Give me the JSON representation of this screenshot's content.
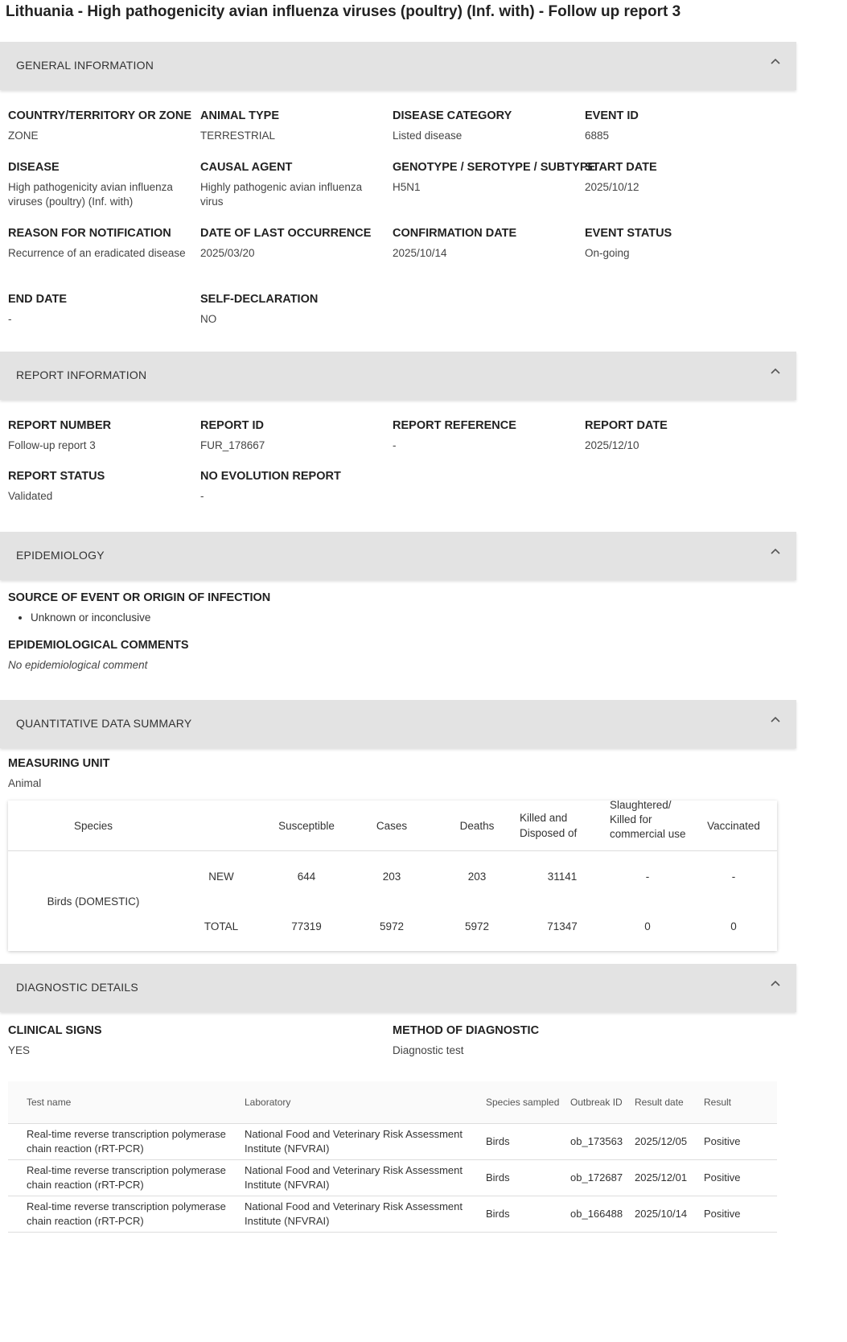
{
  "title": "Lithuania - High pathogenicity avian influenza viruses (poultry) (Inf. with) - Follow up report 3",
  "general": {
    "header": "GENERAL INFORMATION",
    "fields": [
      {
        "label": "COUNTRY/TERRITORY OR ZONE",
        "value": "ZONE"
      },
      {
        "label": "ANIMAL TYPE",
        "value": "TERRESTRIAL"
      },
      {
        "label": "DISEASE CATEGORY",
        "value": "Listed disease"
      },
      {
        "label": "EVENT ID",
        "value": "6885"
      },
      {
        "label": "DISEASE",
        "value": "High pathogenicity avian influenza viruses (poultry) (Inf. with)"
      },
      {
        "label": "CAUSAL AGENT",
        "value": "Highly pathogenic avian influenza virus"
      },
      {
        "label": "GENOTYPE / SEROTYPE / SUBTYPE",
        "value": "H5N1"
      },
      {
        "label": "START DATE",
        "value": "2025/10/12"
      },
      {
        "label": "REASON FOR NOTIFICATION",
        "value": "Recurrence of an eradicated disease"
      },
      {
        "label": "DATE OF LAST OCCURRENCE",
        "value": "2025/03/20"
      },
      {
        "label": "CONFIRMATION DATE",
        "value": "2025/10/14"
      },
      {
        "label": "EVENT STATUS",
        "value": "On-going"
      },
      {
        "label": "END DATE",
        "value": "-"
      },
      {
        "label": "SELF-DECLARATION",
        "value": "NO"
      }
    ]
  },
  "report": {
    "header": "REPORT INFORMATION",
    "fields": [
      {
        "label": "REPORT NUMBER",
        "value": "Follow-up report 3"
      },
      {
        "label": "REPORT ID",
        "value": "FUR_178667"
      },
      {
        "label": "REPORT REFERENCE",
        "value": "-"
      },
      {
        "label": "REPORT DATE",
        "value": "2025/12/10"
      },
      {
        "label": "REPORT STATUS",
        "value": "Validated"
      },
      {
        "label": "NO EVOLUTION REPORT",
        "value": "-"
      }
    ]
  },
  "epidemiology": {
    "header": "EPIDEMIOLOGY",
    "source_label": "SOURCE OF EVENT OR ORIGIN OF INFECTION",
    "source_item": "Unknown or inconclusive",
    "comments_label": "EPIDEMIOLOGICAL COMMENTS",
    "comments_value": "No epidemiological comment"
  },
  "quantitative": {
    "header": "QUANTITATIVE DATA SUMMARY",
    "unit_label": "MEASURING UNIT",
    "unit_value": "Animal",
    "columns": {
      "species": "Species",
      "susceptible": "Susceptible",
      "cases": "Cases",
      "deaths": "Deaths",
      "killed": "Killed and Disposed of",
      "slaughtered": "Slaughtered/ Killed for commercial use",
      "vaccinated": "Vaccinated"
    },
    "species_name": "Birds (DOMESTIC)",
    "rows": [
      {
        "type": "NEW",
        "susceptible": "644",
        "cases": "203",
        "deaths": "203",
        "killed": "31141",
        "slaughtered": "-",
        "vaccinated": "-"
      },
      {
        "type": "TOTAL",
        "susceptible": "77319",
        "cases": "5972",
        "deaths": "5972",
        "killed": "71347",
        "slaughtered": "0",
        "vaccinated": "0"
      }
    ]
  },
  "diagnostic": {
    "header": "DIAGNOSTIC DETAILS",
    "clinical_label": "CLINICAL SIGNS",
    "clinical_value": "YES",
    "method_label": "METHOD OF DIAGNOSTIC",
    "method_value": "Diagnostic test",
    "columns": {
      "test": "Test name",
      "lab": "Laboratory",
      "species": "Species sampled",
      "outbreak": "Outbreak ID",
      "date": "Result date",
      "result": "Result"
    },
    "rows": [
      {
        "test": "Real-time reverse transcription polymerase chain reaction (rRT-PCR)",
        "lab": "National Food and Veterinary Risk Assessment Institute (NFVRAI)",
        "species": "Birds",
        "outbreak": "ob_173563",
        "date": "2025/12/05",
        "result": "Positive"
      },
      {
        "test": "Real-time reverse transcription polymerase chain reaction (rRT-PCR)",
        "lab": "National Food and Veterinary Risk Assessment Institute (NFVRAI)",
        "species": "Birds",
        "outbreak": "ob_172687",
        "date": "2025/12/01",
        "result": "Positive"
      },
      {
        "test": "Real-time reverse transcription polymerase chain reaction (rRT-PCR)",
        "lab": "National Food and Veterinary Risk Assessment Institute (NFVRAI)",
        "species": "Birds",
        "outbreak": "ob_166488",
        "date": "2025/10/14",
        "result": "Positive"
      }
    ]
  },
  "icons": {
    "collapse": "chevron-up-icon",
    "bullet": "bullet-icon"
  }
}
